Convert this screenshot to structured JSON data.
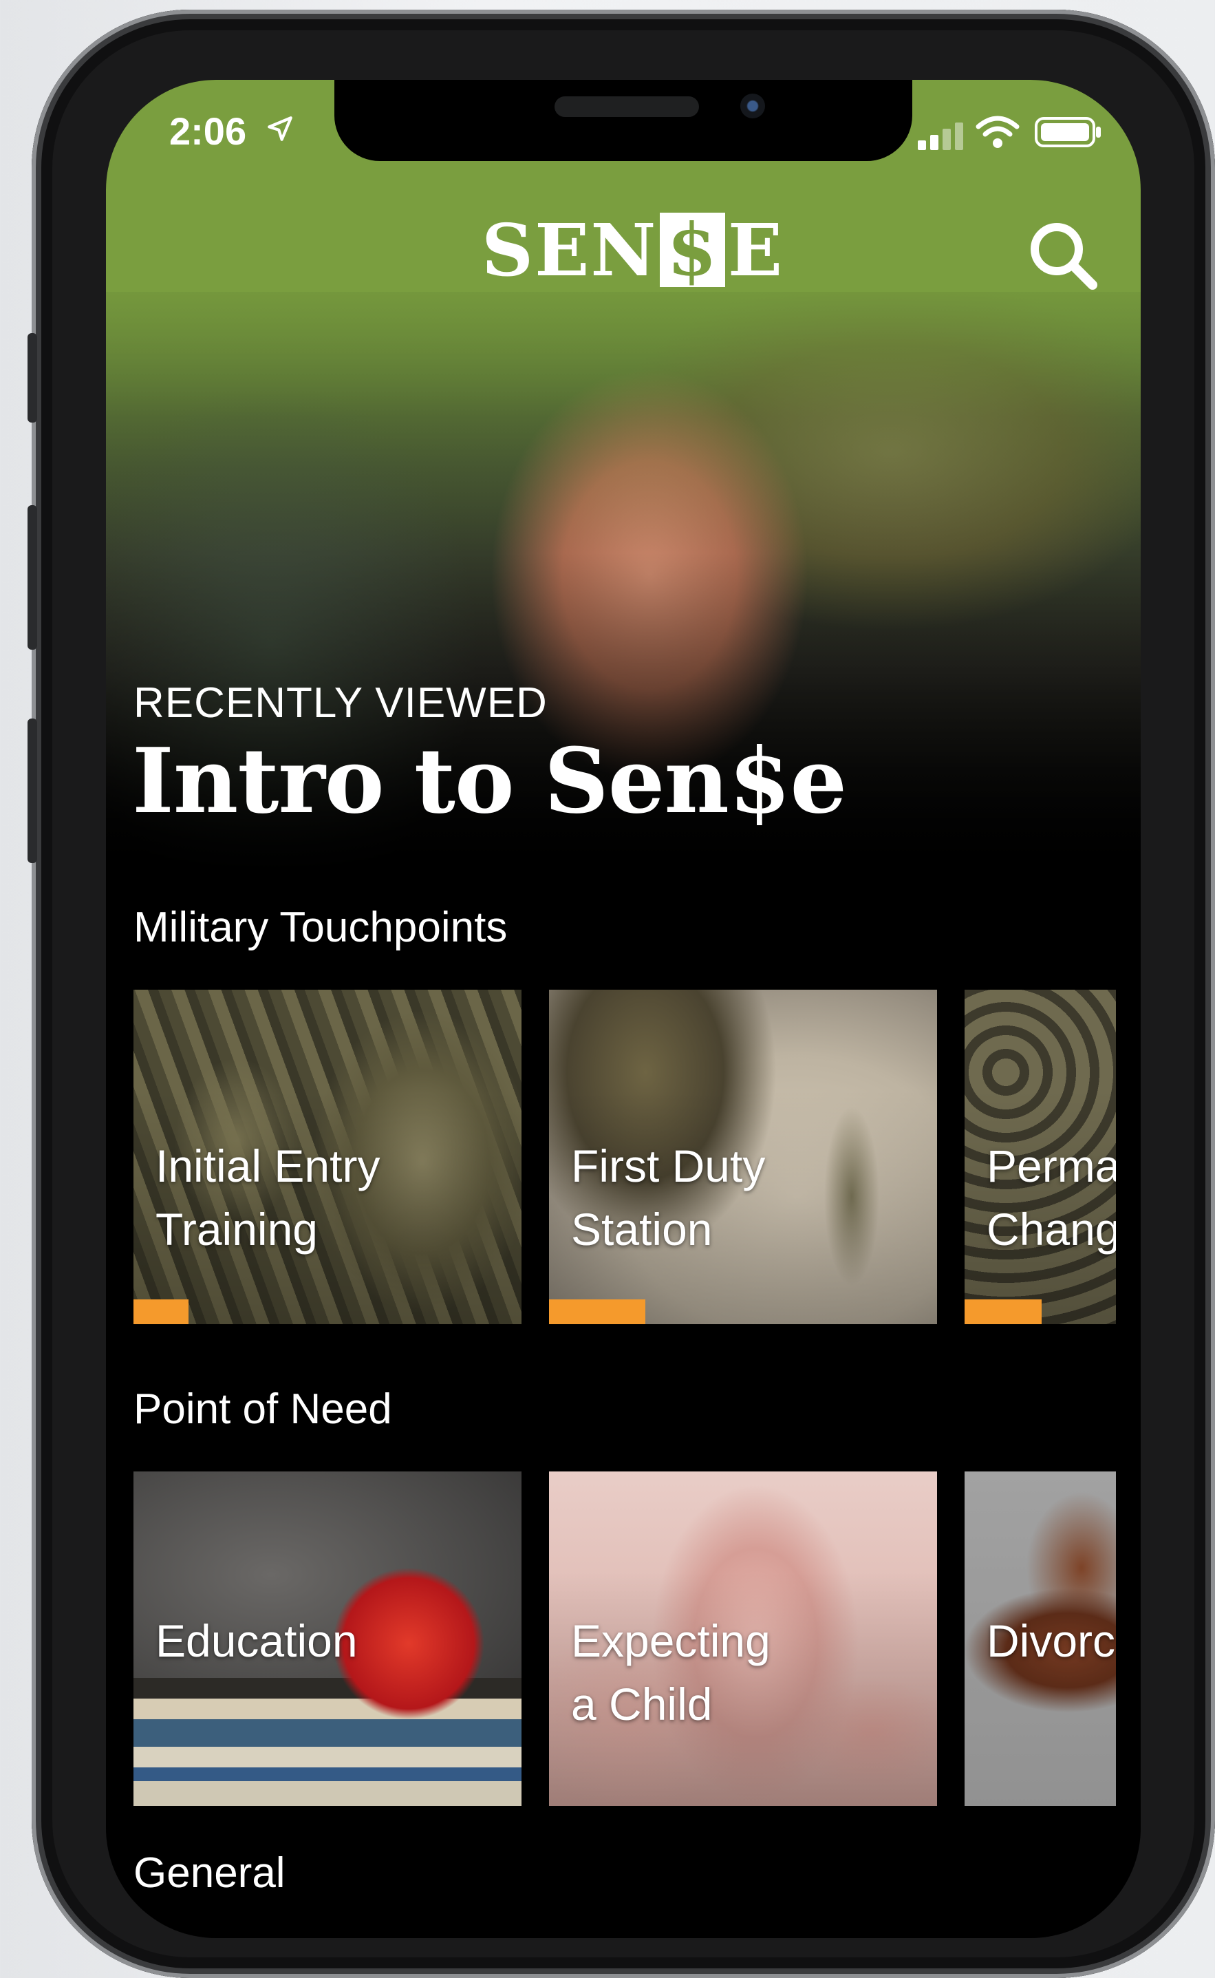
{
  "status_bar": {
    "time": "2:06",
    "icons": [
      "location-arrow-icon",
      "signal-icon",
      "wifi-icon",
      "battery-icon"
    ]
  },
  "header": {
    "logo_text_left": "SEN",
    "logo_text_symbol": "$",
    "logo_text_right": "E",
    "search_icon": "search-icon",
    "brand_color": "#7a9e3f"
  },
  "hero": {
    "eyebrow": "RECENTLY VIEWED",
    "title": "Intro to Sen$e"
  },
  "sections": {
    "military": {
      "title": "Military Touchpoints",
      "cards": [
        {
          "label": "Initial Entry\nTraining",
          "progress": 0.14
        },
        {
          "label": "First Duty\nStation",
          "progress": 0.25
        },
        {
          "label": "Perma\nChang",
          "progress": 0.5
        }
      ]
    },
    "need": {
      "title": "Point of Need",
      "cards": [
        {
          "label": "Education"
        },
        {
          "label": "Expecting\na Child"
        },
        {
          "label": "Divorc"
        }
      ]
    },
    "general": {
      "title": "General"
    }
  },
  "colors": {
    "accent_progress": "#f59a2c",
    "background": "#000000"
  }
}
